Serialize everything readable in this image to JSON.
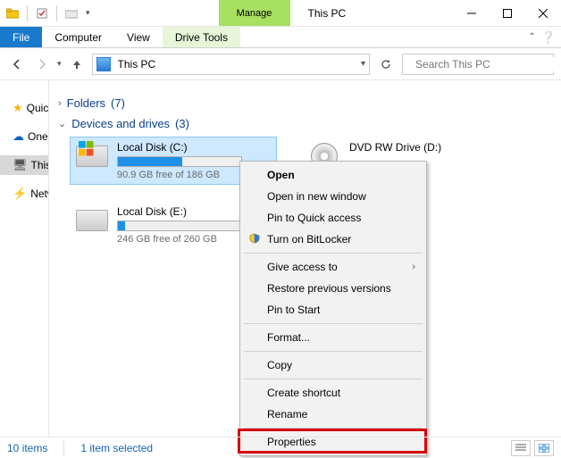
{
  "window": {
    "title": "This PC",
    "ribbon_ctx_label": "Manage",
    "ribbon_ctx_tab": "Drive Tools"
  },
  "tabs": {
    "file": "File",
    "computer": "Computer",
    "view": "View"
  },
  "address": {
    "path": "This PC"
  },
  "search": {
    "placeholder": "Search This PC"
  },
  "sidebar": {
    "quick": "Quick access",
    "onedrive": "OneDrive",
    "thispc": "This PC",
    "network": "Network"
  },
  "groups": {
    "folders": {
      "label": "Folders",
      "count": "(7)"
    },
    "drives": {
      "label": "Devices and drives",
      "count": "(3)"
    }
  },
  "drives": {
    "c": {
      "name": "Local Disk (C:)",
      "sub": "90.9 GB free of 186 GB",
      "fill_pct": 52
    },
    "e": {
      "name": "Local Disk (E:)",
      "sub": "246 GB free of 260 GB",
      "fill_pct": 6
    },
    "d": {
      "name": "DVD RW Drive (D:)"
    }
  },
  "context_menu": {
    "open": "Open",
    "open_new": "Open in new window",
    "pin_quick": "Pin to Quick access",
    "bitlocker": "Turn on BitLocker",
    "give_access": "Give access to",
    "restore": "Restore previous versions",
    "pin_start": "Pin to Start",
    "format": "Format...",
    "copy": "Copy",
    "shortcut": "Create shortcut",
    "rename": "Rename",
    "properties": "Properties"
  },
  "status": {
    "items": "10 items",
    "selected": "1 item selected"
  }
}
